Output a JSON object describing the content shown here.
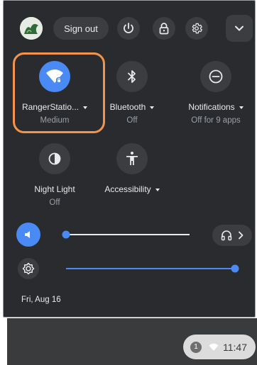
{
  "header": {
    "sign_out_label": "Sign out",
    "icons": [
      "avatar",
      "power-icon",
      "lock-icon",
      "settings-icon",
      "collapse-chevron-icon"
    ]
  },
  "tiles": {
    "network": {
      "label": "RangerStatio...",
      "sub": "Medium"
    },
    "bluetooth": {
      "label": "Bluetooth",
      "sub": "Off"
    },
    "notifications": {
      "label": "Notifications",
      "sub": "Off for 9 apps"
    },
    "night_light": {
      "label": "Night Light",
      "sub": "Off"
    },
    "accessibility": {
      "label": "Accessibility",
      "sub": ""
    }
  },
  "sliders": {
    "volume": {
      "level": 0.0
    },
    "brightness": {
      "level": 1.0
    }
  },
  "footer": {
    "date": "Fri, Aug 16"
  },
  "tray": {
    "notification_count": "1",
    "time": "11:47"
  },
  "colors": {
    "panel_bg": "#2a2b2e",
    "accent": "#4a8af4",
    "highlight": "#f3944a"
  }
}
